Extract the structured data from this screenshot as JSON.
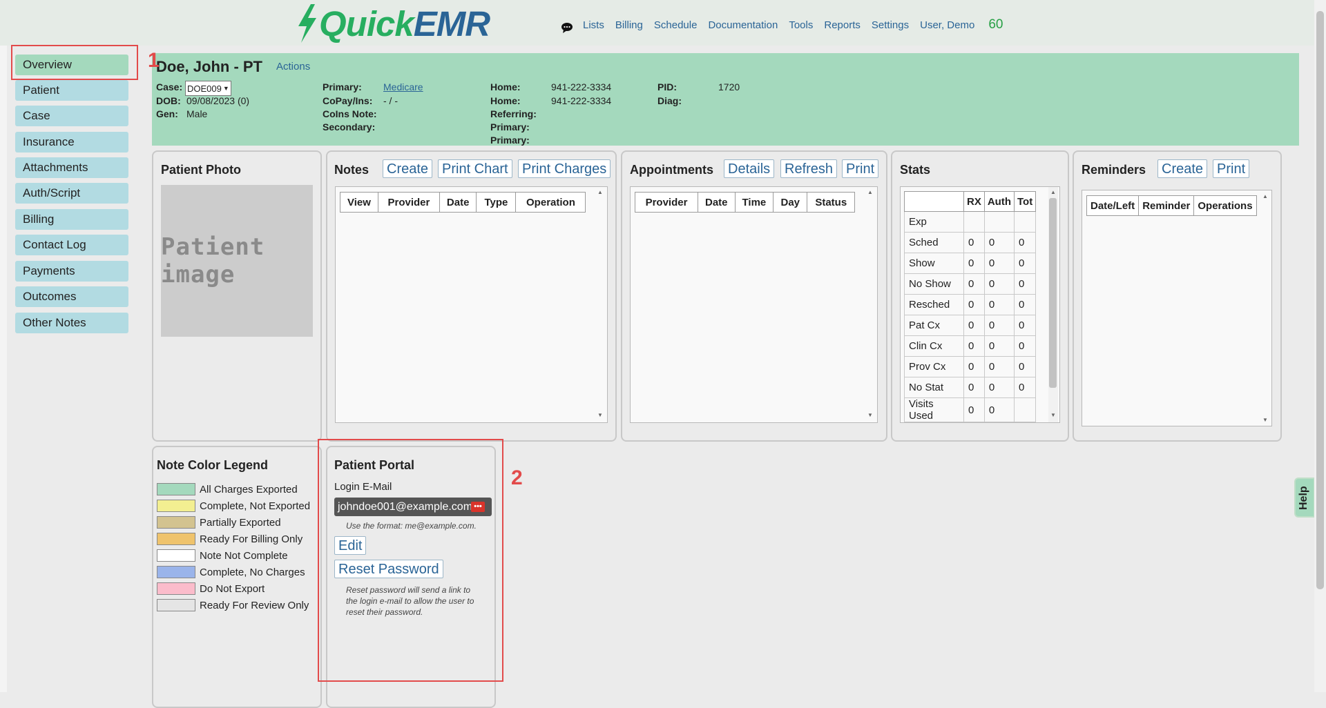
{
  "app": {
    "name_part1": "Quick",
    "name_part2": "EMR"
  },
  "nav": {
    "items": [
      "Lists",
      "Billing",
      "Schedule",
      "Documentation",
      "Tools",
      "Reports",
      "Settings",
      "User, Demo"
    ],
    "count": "60"
  },
  "sidebar": {
    "items": [
      "Overview",
      "Patient",
      "Case",
      "Insurance",
      "Attachments",
      "Auth/Script",
      "Billing",
      "Contact Log",
      "Payments",
      "Outcomes",
      "Other Notes"
    ],
    "active": "Overview"
  },
  "annotations": {
    "one": "1",
    "two": "2"
  },
  "patient": {
    "name": "Doe, John - PT",
    "actions": "Actions",
    "case_label": "Case:",
    "case_value": "DOE009",
    "dob_label": "DOB:",
    "dob_value": "09/08/2023 (0)",
    "gen_label": "Gen:",
    "gen_value": "Male",
    "primary_label": "Primary:",
    "primary_value": "Medicare",
    "copay_label": "CoPay/Ins:",
    "copay_value": "- / -",
    "coins_label": "CoIns Note:",
    "secondary_label": "Secondary:",
    "home1_label": "Home:",
    "home1_value": "941-222-3334",
    "home2_label": "Home:",
    "home2_value": "941-222-3334",
    "referring_label": "Referring:",
    "primary2_label": "Primary:",
    "primary3_label": "Primary:",
    "pid_label": "PID:",
    "pid_value": "1720",
    "diag_label": "Diag:"
  },
  "photo_panel": {
    "title": "Patient Photo",
    "placeholder": "Patient image"
  },
  "notes_panel": {
    "title": "Notes",
    "buttons": [
      "Create",
      "Print Chart",
      "Print Charges"
    ],
    "columns": [
      "View",
      "Provider",
      "Date",
      "Type",
      "Operation"
    ]
  },
  "appointments_panel": {
    "title": "Appointments",
    "buttons": [
      "Details",
      "Refresh",
      "Print"
    ],
    "columns": [
      "Provider",
      "Date",
      "Time",
      "Day",
      "Status"
    ]
  },
  "stats_panel": {
    "title": "Stats",
    "columns": [
      "",
      "RX",
      "Auth",
      "Tot"
    ],
    "rows": [
      [
        "Exp",
        "",
        "",
        ""
      ],
      [
        "Sched",
        "0",
        "0",
        "0"
      ],
      [
        "Show",
        "0",
        "0",
        "0"
      ],
      [
        "No Show",
        "0",
        "0",
        "0"
      ],
      [
        "Resched",
        "0",
        "0",
        "0"
      ],
      [
        "Pat Cx",
        "0",
        "0",
        "0"
      ],
      [
        "Clin Cx",
        "0",
        "0",
        "0"
      ],
      [
        "Prov Cx",
        "0",
        "0",
        "0"
      ],
      [
        "No Stat",
        "0",
        "0",
        "0"
      ],
      [
        "Visits Used",
        "0",
        "0",
        ""
      ]
    ]
  },
  "reminders_panel": {
    "title": "Reminders",
    "buttons": [
      "Create",
      "Print"
    ],
    "columns": [
      "Date/Left",
      "Reminder",
      "Operations"
    ]
  },
  "legend_panel": {
    "title": "Note Color Legend",
    "items": [
      {
        "label": "All Charges Exported",
        "color": "#a4d9bd"
      },
      {
        "label": "Complete, Not Exported",
        "color": "#f3ef91"
      },
      {
        "label": "Partially Exported",
        "color": "#d3c390"
      },
      {
        "label": "Ready For Billing Only",
        "color": "#efc36c"
      },
      {
        "label": "Note Not Complete",
        "color": "#ffffff"
      },
      {
        "label": "Complete, No Charges",
        "color": "#9ab4ea"
      },
      {
        "label": "Do Not Export",
        "color": "#fbbccb"
      },
      {
        "label": "Ready For Review Only",
        "color": "#e5e5e5"
      }
    ]
  },
  "portal_panel": {
    "title": "Patient Portal",
    "email_label": "Login E-Mail",
    "email_value": "johndoe001@example.com",
    "dots": "•••",
    "email_hint": "Use the format: me@example.com.",
    "edit_button": "Edit",
    "reset_button": "Reset Password",
    "reset_hint_1": "Reset password will send a link to",
    "reset_hint_2": "the login e-mail to allow the user to",
    "reset_hint_3": "reset their password."
  },
  "help_tab": {
    "label": "Help"
  },
  "colors": {
    "accent_green": "#a4d9bd",
    "side_blue": "#b2dbe2",
    "link": "#2a6496",
    "annotation_red": "#e24a4a"
  }
}
